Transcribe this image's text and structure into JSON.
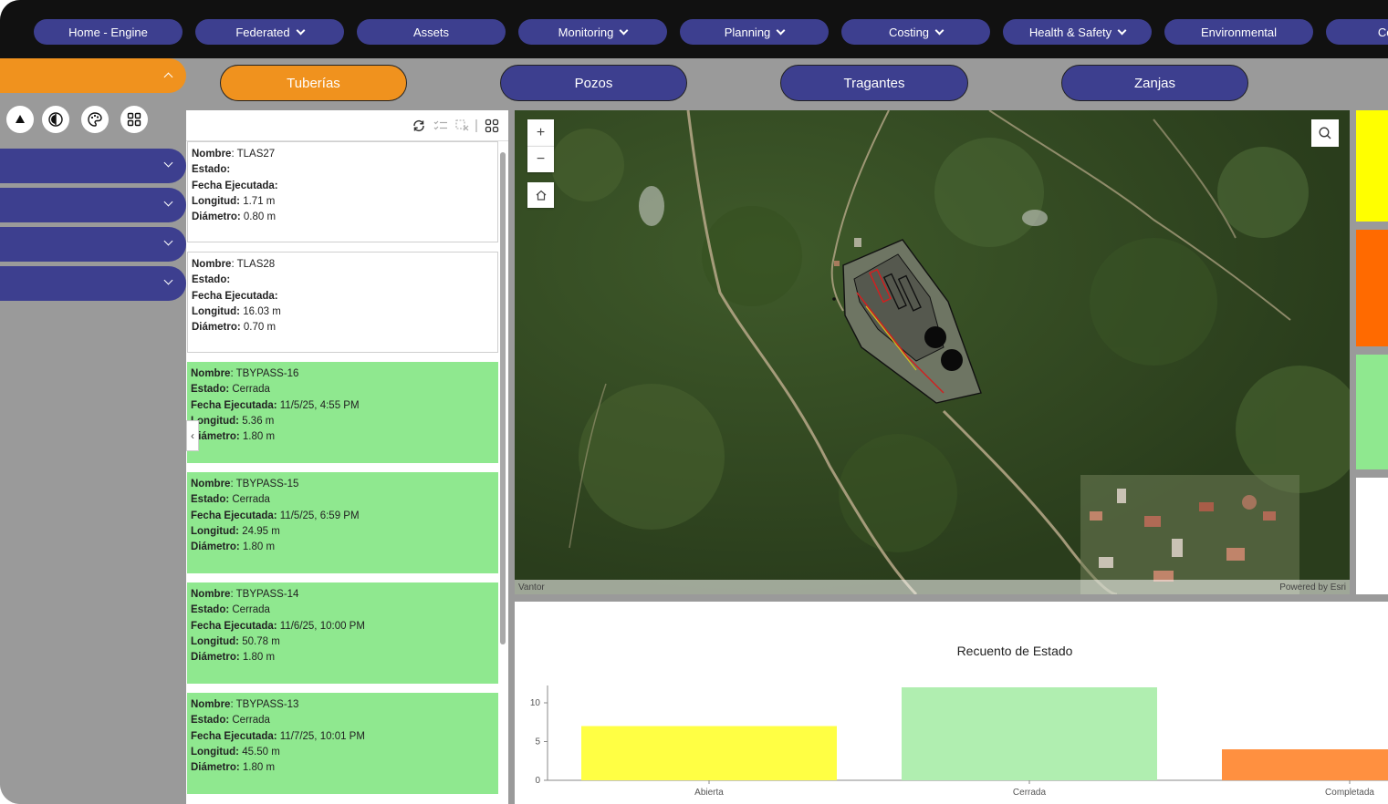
{
  "nav": {
    "items": [
      {
        "label": "Home - Engine",
        "dropdown": false
      },
      {
        "label": "Federated",
        "dropdown": true
      },
      {
        "label": "Assets",
        "dropdown": false
      },
      {
        "label": "Monitoring",
        "dropdown": true
      },
      {
        "label": "Planning",
        "dropdown": true
      },
      {
        "label": "Costing",
        "dropdown": true
      },
      {
        "label": "Health & Safety",
        "dropdown": true
      },
      {
        "label": "Environmental",
        "dropdown": false
      },
      {
        "label": "Contract",
        "dropdown": false
      }
    ]
  },
  "sidebar": {
    "icons": [
      "triangle-icon",
      "compass-icon",
      "palette-icon",
      "grid-icon"
    ]
  },
  "tabs": [
    {
      "label": "Tuberías",
      "active": true
    },
    {
      "label": "Pozos",
      "active": false
    },
    {
      "label": "Tragantes",
      "active": false
    },
    {
      "label": "Zanjas",
      "active": false
    }
  ],
  "list": {
    "labels": {
      "nombre": "Nombre",
      "estado": "Estado:",
      "fecha": "Fecha Ejecutada:",
      "longitud": "Longitud:",
      "diametro": "Diámetro:"
    },
    "records": [
      {
        "nombre": "TLAS27",
        "estado": "",
        "fecha": "",
        "longitud": "1.71 m",
        "diametro": "0.80 m",
        "status_color": "white"
      },
      {
        "nombre": "TLAS28",
        "estado": "",
        "fecha": "",
        "longitud": "16.03 m",
        "diametro": "0.70 m",
        "status_color": "white"
      },
      {
        "nombre": "TBYPASS-16",
        "estado": "Cerrada",
        "fecha": "11/5/25, 4:55 PM",
        "longitud": "5.36 m",
        "diametro": "1.80 m",
        "status_color": "green"
      },
      {
        "nombre": "TBYPASS-15",
        "estado": "Cerrada",
        "fecha": "11/5/25, 6:59 PM",
        "longitud": "24.95 m",
        "diametro": "1.80 m",
        "status_color": "green"
      },
      {
        "nombre": "TBYPASS-14",
        "estado": "Cerrada",
        "fecha": "11/6/25, 10:00 PM",
        "longitud": "50.78 m",
        "diametro": "1.80 m",
        "status_color": "green"
      },
      {
        "nombre": "TBYPASS-13",
        "estado": "Cerrada",
        "fecha": "11/7/25, 10:01 PM",
        "longitud": "45.50 m",
        "diametro": "1.80 m",
        "status_color": "green"
      }
    ]
  },
  "map": {
    "attribution_left": "Vantor",
    "attribution_right": "Powered by Esri",
    "zoom_in": "+",
    "zoom_out": "−"
  },
  "status_colors": [
    "#ffff00",
    "#ff6a00",
    "#8fe88f",
    "#ffffff"
  ],
  "chart_data": {
    "type": "bar",
    "title": "Recuento de Estado",
    "categories": [
      "Abierta",
      "Cerrada",
      "Completada"
    ],
    "values": [
      7,
      12,
      4
    ],
    "colors": [
      "#ffff44",
      "#b0eeb0",
      "#ff9040"
    ],
    "yticks": [
      0,
      5,
      10
    ],
    "ylim": [
      0,
      12
    ],
    "xlabel": "",
    "ylabel": ""
  }
}
